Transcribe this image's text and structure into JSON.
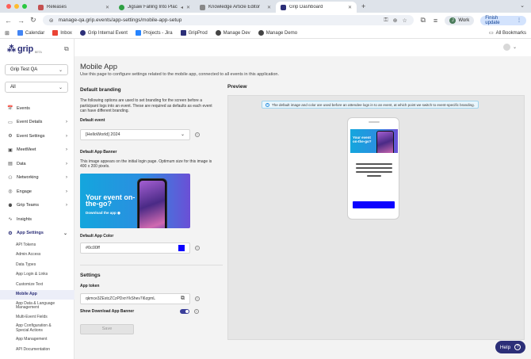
{
  "browser": {
    "tabs": [
      {
        "title": "Releases",
        "active": false,
        "color": "#c45050"
      },
      {
        "title": "Jigsaw Falling Into Place",
        "active": false,
        "color": "#2ea043"
      },
      {
        "title": "Knowledge Article Editor",
        "active": false,
        "color": "#888888"
      },
      {
        "title": "Grip Dashboard",
        "active": true,
        "color": "#2c2f78"
      }
    ],
    "new_tab": "+",
    "url": "manage-qa.grip.events/app-settings/mobile-app-setup",
    "profile_initial": "J",
    "profile_label": "Work",
    "finish_update": "Finish update",
    "bookmarks": [
      "Calendar",
      "Inbox",
      "Grip Internal Event",
      "Projects - Jira",
      "GripProd",
      "Manage Dev",
      "Manage Demo"
    ],
    "all_bookmarks": "All Bookmarks"
  },
  "sidebar": {
    "logo_text": "grip",
    "logo_beta": "BETA",
    "org_select": "Grip Test QA",
    "event_select": "All",
    "items": [
      {
        "label": "Events",
        "icon": "📅",
        "chevron": false
      },
      {
        "label": "Event Details",
        "icon": "▭",
        "chevron": true
      },
      {
        "label": "Event Settings",
        "icon": "⚙",
        "chevron": true
      },
      {
        "label": "MeetMeet",
        "icon": "▣",
        "chevron": true
      },
      {
        "label": "Data",
        "icon": "▤",
        "chevron": true
      },
      {
        "label": "Networking",
        "icon": "⚇",
        "chevron": true
      },
      {
        "label": "Engage",
        "icon": "◎",
        "chevron": true
      },
      {
        "label": "Grip Teams",
        "icon": "⚉",
        "chevron": true
      },
      {
        "label": "Insights",
        "icon": "∿",
        "chevron": false
      },
      {
        "label": "App Settings",
        "icon": "⚙",
        "chevron": true
      }
    ],
    "sub_items": [
      "API Tokens",
      "Admin Access",
      "Data Types",
      "App Login & Links",
      "Customize Text",
      "Mobile App",
      "App Data & Language Management",
      "Multi-Event Fields",
      "App Configuration & Special Actions",
      "App Management",
      "API Documentation"
    ]
  },
  "page": {
    "title": "Mobile App",
    "description": "Use this page to configure settings related to the mobile app, connected to all events in this application.",
    "default_branding": {
      "heading": "Default branding",
      "intro": "The following options are used to set branding for the screen before a participant logs into an event. These are required as defaults as each event can have different branding.",
      "event_label": "Default event",
      "event_value": "[HelloWorld] 2024",
      "banner_label": "Default App Banner",
      "banner_help": "This image appears on the initial login page. Optimum size for this image is 400 x 200 pixels.",
      "banner_title": "Your event on-the-go?",
      "banner_sub": "Download the app ◉",
      "color_label": "Default App Color",
      "color_value": "#0c00ff"
    },
    "settings": {
      "heading": "Settings",
      "token_label": "App token",
      "token_value": "qkmce3ZEstcZCzPDxnYkShev7i6zgrnL",
      "download_label": "Show Download App Banner",
      "download_enabled": true,
      "save_label": "Save"
    },
    "preview": {
      "heading": "Preview",
      "notice": "The default image and color are used before an attendee logs in to an event, at which point we switch to event-specific branding.",
      "mock_banner_title": "Your event on-the-go?"
    }
  },
  "help_label": "Help",
  "colors": {
    "brand": "#2c2f78",
    "app_color": "#0c00ff"
  }
}
